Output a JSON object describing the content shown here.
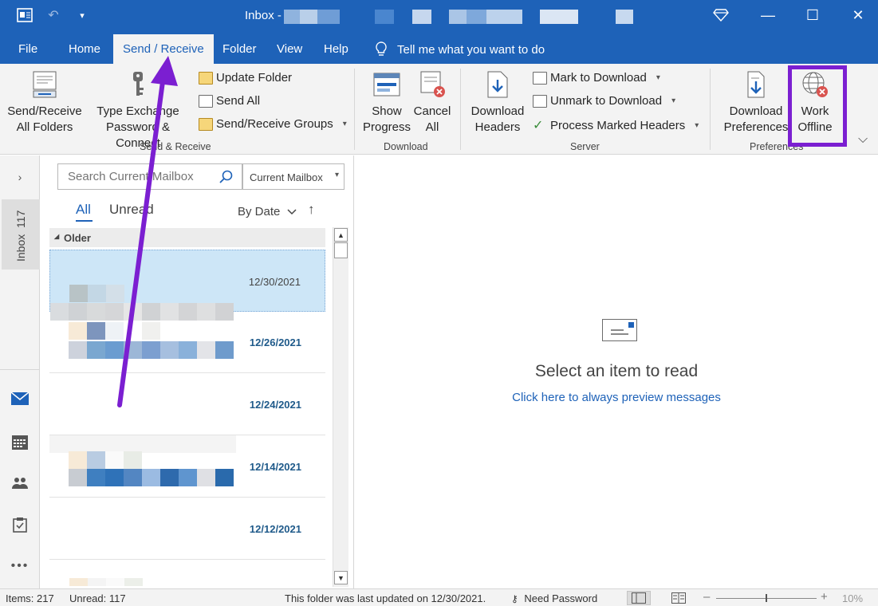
{
  "window": {
    "title": "Inbox -",
    "minimize": "—",
    "restore": "☐",
    "close": "✕"
  },
  "menu": {
    "tabs": [
      "File",
      "Home",
      "Send / Receive",
      "Folder",
      "View",
      "Help"
    ],
    "tell_me": "Tell me what you want to do"
  },
  "ribbon": {
    "send_receive": {
      "send_receive_all_line1": "Send/Receive",
      "send_receive_all_line2": "All Folders",
      "type_exchange_line1": "Type Exchange",
      "type_exchange_line2": "Password & Connect",
      "update_folder": "Update Folder",
      "send_all": "Send All",
      "send_receive_groups": "Send/Receive Groups",
      "group_label": "Send & Receive"
    },
    "download": {
      "show_progress_line1": "Show",
      "show_progress_line2": "Progress",
      "cancel_all_line1": "Cancel",
      "cancel_all_line2": "All",
      "group_label": "Download"
    },
    "server": {
      "download_headers_line1": "Download",
      "download_headers_line2": "Headers",
      "mark_to_download": "Mark to Download",
      "unmark_to_download": "Unmark to Download",
      "process_marked_headers": "Process Marked Headers",
      "group_label": "Server"
    },
    "preferences": {
      "download_prefs_line1": "Download",
      "download_prefs_line2": "Preferences",
      "work_offline_line1": "Work",
      "work_offline_line2": "Offline",
      "group_label": "Preferences"
    }
  },
  "rail": {
    "inbox_label": "Inbox",
    "inbox_count": "117"
  },
  "message_list": {
    "search_placeholder": "Search Current Mailbox",
    "scope": "Current Mailbox",
    "filter_all": "All",
    "filter_unread": "Unread",
    "sort_by": "By Date",
    "group_header": "Older",
    "messages": [
      {
        "date": "12/30/2021",
        "selected": true
      },
      {
        "date": "12/26/2021",
        "selected": false
      },
      {
        "date": "12/24/2021",
        "selected": false
      },
      {
        "date": "12/14/2021",
        "selected": false
      },
      {
        "date": "12/12/2021",
        "selected": false
      }
    ]
  },
  "reading_pane": {
    "empty_text": "Select an item to read",
    "preview_link": "Click here to always preview messages"
  },
  "status_bar": {
    "items": "Items: 217",
    "unread": "Unread: 117",
    "last_updated": "This folder was last updated on 12/30/2021.",
    "need_password": "Need Password",
    "zoom": "10%"
  },
  "colors": {
    "accent": "#1e62b8",
    "highlight": "#7b1fd1",
    "selected_row": "#cde6f7"
  }
}
